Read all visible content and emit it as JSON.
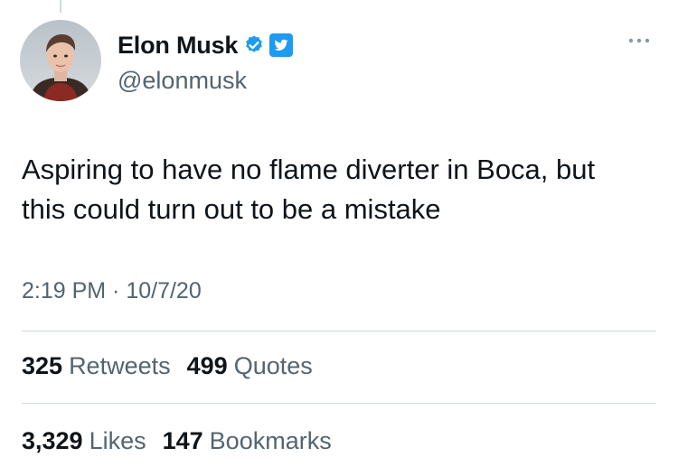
{
  "tweet": {
    "author": {
      "display_name": "Elon Musk",
      "handle": "@elonmusk",
      "verified": true,
      "avatar_icon": "profile-photo",
      "badge_icon": "verified-check-icon",
      "platform_icon": "twitter-bird-icon"
    },
    "text_line1": "Aspiring to have no flame diverter in Boca, but",
    "text_line2": "this could turn out to be a mistake",
    "timestamp": "2:19 PM · 10/7/20",
    "stats": {
      "retweets": {
        "count": "325",
        "label": "Retweets"
      },
      "quotes": {
        "count": "499",
        "label": "Quotes"
      },
      "likes": {
        "count": "3,329",
        "label": "Likes"
      },
      "bookmarks": {
        "count": "147",
        "label": "Bookmarks"
      }
    }
  },
  "colors": {
    "text_primary": "#0f1419",
    "text_secondary": "#536471",
    "divider": "#cfd9de",
    "verified_blue": "#1d9bf0"
  }
}
